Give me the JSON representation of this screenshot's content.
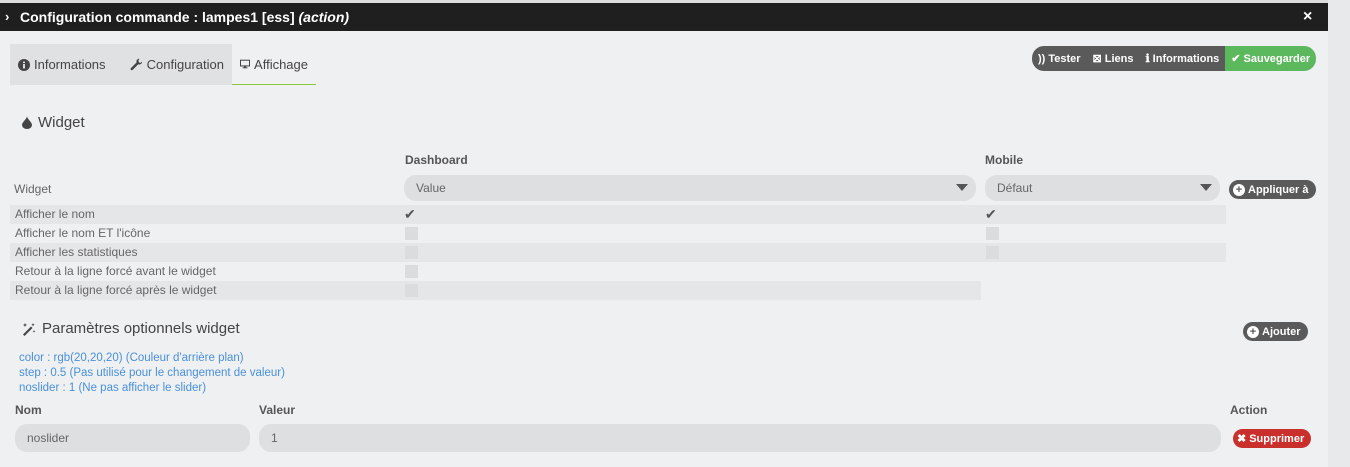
{
  "titlebar": {
    "prefix": "Configuration commande : lampes1 [ess]",
    "action": "(action)",
    "close": "×",
    "chevron": "›"
  },
  "tabs": [
    {
      "label": "Informations",
      "icon": "info-circle-icon"
    },
    {
      "label": "Configuration",
      "icon": "wrench-icon"
    },
    {
      "label": "Affichage",
      "icon": "desktop-icon",
      "active": true
    }
  ],
  "actions": {
    "tester": "Tester",
    "liens": "Liens",
    "informations": "Informations",
    "sauvegarder": "Sauvegarder"
  },
  "widget_section": {
    "title": "Widget",
    "dashboard_header": "Dashboard",
    "mobile_header": "Mobile",
    "widget_label": "Widget",
    "dashboard_value": "Value",
    "mobile_value": "Défaut",
    "apply_label": "Appliquer à",
    "rows": [
      {
        "label": "Afficher le nom",
        "dashboard": true,
        "mobile": true
      },
      {
        "label": "Afficher le nom ET l'icône",
        "dashboard": false,
        "mobile": false
      },
      {
        "label": "Afficher les statistiques",
        "dashboard": false,
        "mobile": false
      },
      {
        "label": "Retour à la ligne forcé avant le widget",
        "dashboard": false
      },
      {
        "label": "Retour à la ligne forcé après le widget",
        "dashboard": false
      }
    ]
  },
  "params_section": {
    "title": "Paramètres optionnels widget",
    "add_label": "Ajouter",
    "hints": [
      "color : rgb(20,20,20) (Couleur d'arrière plan)",
      "step : 0.5 (Pas utilisé pour le changement de valeur)",
      "noslider : 1 (Ne pas afficher le slider)"
    ],
    "col_nom": "Nom",
    "col_valeur": "Valeur",
    "col_action": "Action",
    "entry": {
      "nom": "noslider",
      "valeur": "1",
      "delete_label": "Supprimer"
    }
  },
  "colors": {
    "accent_green": "#5cb85c",
    "danger": "#c9302c",
    "link": "#4a90d9",
    "titlebar": "#1f1f1f"
  }
}
